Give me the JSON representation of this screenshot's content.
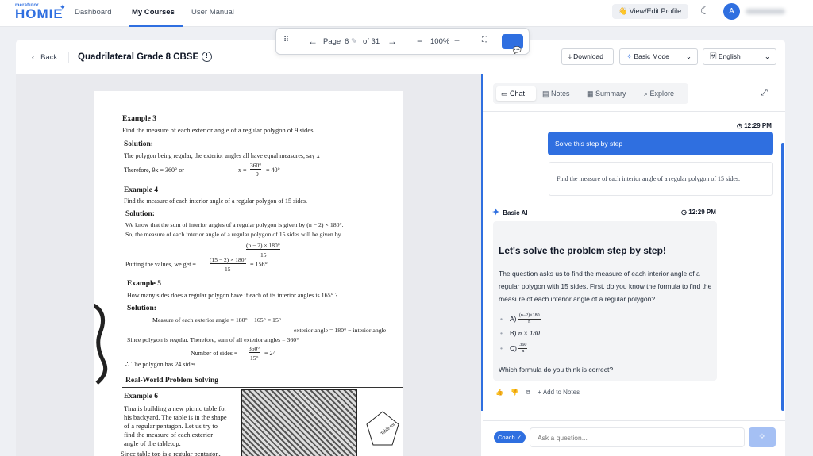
{
  "brand": {
    "top": "meratutor",
    "main": "HOMIE"
  },
  "nav": {
    "links": [
      "Dashboard",
      "My Courses",
      "User Manual"
    ]
  },
  "header": {
    "profile_button": "👋 View/Edit Profile",
    "avatar_letter": "A"
  },
  "doc": {
    "back_label": "Back",
    "title": "Quadrilateral Grade 8 CBSE"
  },
  "pdf_toolbar": {
    "page_label": "Page",
    "page_current": "6",
    "page_total_label": "of 31",
    "zoom": "100%"
  },
  "controls": {
    "download": "Download",
    "mode": "Basic Mode",
    "language": "English"
  },
  "page_text": {
    "ex3": "Example 3",
    "ex3_q": "Find the measure of each exterior angle of a regular polygon of 9 sides.",
    "sol": "Solution:",
    "ex3_s1": "The polygon being regular, the exterior angles all have equal measures, say x",
    "ex3_s2": "Therefore, 9x = 360° or",
    "ex3_s3_num": "360°",
    "ex3_s3_pre": "x =",
    "ex3_s3_den": "9",
    "ex3_s3_post": "= 40°",
    "ex4": "Example 4",
    "ex4_q": "Find the measure of each interior angle of a regular polygon of 15 sides.",
    "ex4_s1": "We know that the sum of interior angles of a regular polygon is given by (n − 2) × 180°.",
    "ex4_s2": "So, the measure of each interior angle of a regular polygon of 15 sides will be given by",
    "ex4_f1_num": "(n − 2) × 180°",
    "ex4_f1_den": "15",
    "ex4_s3": "Putting the values, we get =",
    "ex4_f2_num": "(15 − 2) × 180°",
    "ex4_f2_den": "15",
    "ex4_f2_post": "= 156°",
    "ex5": "Example 5",
    "ex5_q": "How many sides does a regular polygon have if each of its interior angles is 165° ?",
    "ex5_s1": "Measure of each exterior angle = 180° − 165° = 15°",
    "ex5_s2": "exterior angle = 180° −  interior angle",
    "ex5_s3": "Since polygon is regular. Therefore, sum of all exterior angles = 360°",
    "ex5_s4_pre": "Number of sides =",
    "ex5_s4_num": "360°",
    "ex5_s4_den": "15°",
    "ex5_s4_post": "= 24",
    "ex5_s5": "∴ The polygon has 24 sides.",
    "rw": "Real-World Problem Solving",
    "ex6": "Example 6",
    "ex6_l1": "Tina is building a new picnic table for",
    "ex6_l2": "his backyard. The table is in the shape",
    "ex6_l3": "of a regular pentagon. Let us try to",
    "ex6_l4": "find the measure of each exterior",
    "ex6_l5": "angle of the tabletop.",
    "ex6_l6": "Since table top is a regular pentagon,",
    "pent_label": "Table top"
  },
  "chat": {
    "tabs": [
      "Chat",
      "Notes",
      "Summary",
      "Explore"
    ],
    "time1": "12:29 PM",
    "user_msg": "Solve this step by step",
    "quote": "Find the measure of each interior angle of a regular polygon of 15 sides.",
    "bot_name": "Basic AI",
    "time2": "12:29 PM",
    "heading": "Let's solve the problem step by step!",
    "para": "The question asks us to find the measure of each interior angle of a regular polygon with 15 sides. First, do you know the formula to find the measure of each interior angle of a regular polygon?",
    "opt_a_label": "A)",
    "opt_a_num": "(n−2)×180",
    "opt_a_den": "n",
    "opt_b_label": "B)",
    "opt_b_math": "n × 180",
    "opt_c_label": "C)",
    "opt_c_num": "360",
    "opt_c_den": "n",
    "question": "Which formula do you think is correct?",
    "add_notes": "+ Add to Notes",
    "coach": "Coach",
    "ask_placeholder": "Ask a question..."
  },
  "colors": {
    "accent": "#2f6fe0"
  }
}
